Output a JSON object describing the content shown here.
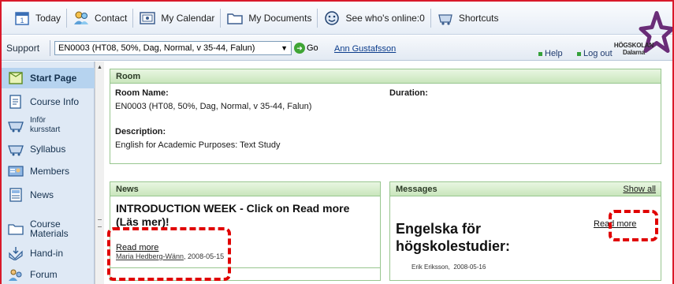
{
  "toolbar": {
    "items": [
      {
        "label": "Today",
        "icon": "calendar-day-icon"
      },
      {
        "label": "Contact",
        "icon": "contacts-icon"
      },
      {
        "label": "My Calendar",
        "icon": "calendar-icon"
      },
      {
        "label": "My Documents",
        "icon": "folder-icon"
      },
      {
        "label": "See who's online:0",
        "icon": "smiley-icon"
      },
      {
        "label": "Shortcuts",
        "icon": "shortcuts-icon"
      }
    ]
  },
  "bar": {
    "support": "Support",
    "room_select": "EN0003 (HT08, 50%, Dag, Normal, v 35-44, Falun)",
    "go": "Go",
    "user": "Ann Gustafsson",
    "help": "Help",
    "logout": "Log out"
  },
  "logo": {
    "line1": "HÖGSKOLAN",
    "line2": "Dalarna"
  },
  "sidebar": {
    "items": [
      {
        "label": "Start Page",
        "icon": "start-page-icon"
      },
      {
        "label": "Course Info",
        "icon": "course-info-icon"
      },
      {
        "label": "Inför kursstart",
        "icon": "basket-icon"
      },
      {
        "label": "Syllabus",
        "icon": "basket-icon"
      },
      {
        "label": "Members",
        "icon": "members-icon"
      },
      {
        "label": "News",
        "icon": "news-icon"
      },
      {
        "label": "Course Materials",
        "icon": "folder-icon"
      },
      {
        "label": "Hand-in",
        "icon": "hand-in-icon"
      },
      {
        "label": "Forum",
        "icon": "forum-icon"
      }
    ]
  },
  "room": {
    "header": "Room",
    "name_label": "Room Name:",
    "name_value": "EN0003 (HT08, 50%, Dag, Normal, v 35-44, Falun)",
    "duration_label": "Duration:",
    "description_label": "Description:",
    "description_value": "English for Academic Purposes: Text Study"
  },
  "news": {
    "header": "News",
    "headline_line1": "INTRODUCTION WEEK - Click on Read more",
    "headline_line2": "(Läs mer)!",
    "read_more": "Read more",
    "author": "Maria Hedberg-Wänn",
    "date": ", 2008-05-15"
  },
  "messages": {
    "header": "Messages",
    "show_all": "Show all",
    "title_line1": "Engelska för",
    "title_line2": "högskolestudier:",
    "read_more": "Read more",
    "author": "Erik Eriksson,",
    "date": "2008-05-16"
  },
  "colors": {
    "frame": "#d9192a",
    "accent_green": "#35a13a",
    "highlight_dash": "#e00000"
  }
}
